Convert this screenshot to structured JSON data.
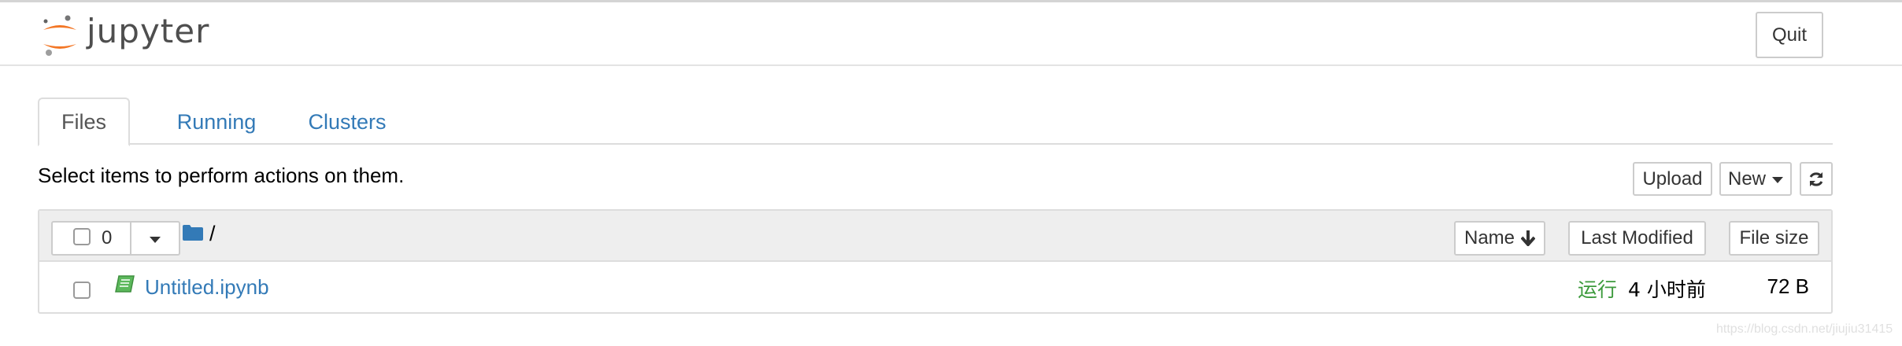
{
  "header": {
    "logo_text": "jupyter",
    "quit_label": "Quit"
  },
  "tabs": [
    {
      "label": "Files",
      "active": true
    },
    {
      "label": "Running",
      "active": false
    },
    {
      "label": "Clusters",
      "active": false
    }
  ],
  "toolbar": {
    "hint": "Select items to perform actions on them.",
    "upload_label": "Upload",
    "new_label": "New",
    "refresh_icon": "refresh-icon"
  },
  "list_header": {
    "selected_count": "0",
    "path": "/",
    "sort_name_label": "Name",
    "sort_modified_label": "Last Modified",
    "sort_size_label": "File size"
  },
  "files": [
    {
      "name": "Untitled.ipynb",
      "icon": "notebook-icon",
      "status": "运行",
      "modified": "4 小时前",
      "size": "72 B"
    }
  ],
  "watermark": "https://blog.csdn.net/jiujiu31415",
  "colors": {
    "link": "#337ab7",
    "running_green": "#3c9a3c",
    "logo_orange": "#f37726",
    "header_bg": "#eeeeee"
  }
}
